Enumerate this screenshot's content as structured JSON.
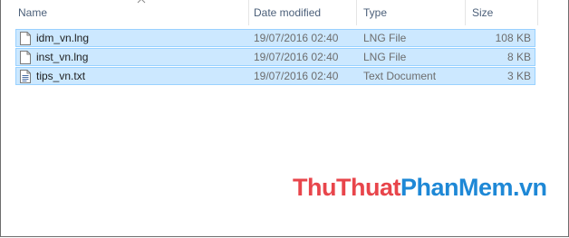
{
  "columns": {
    "name": "Name",
    "date_modified": "Date modified",
    "type": "Type",
    "size": "Size"
  },
  "files": [
    {
      "name": "idm_vn.lng",
      "date": "19/07/2016 02:40",
      "type": "LNG File",
      "size": "108 KB",
      "icon": "document-icon"
    },
    {
      "name": "inst_vn.lng",
      "date": "19/07/2016 02:40",
      "type": "LNG File",
      "size": "8 KB",
      "icon": "document-icon"
    },
    {
      "name": "tips_vn.txt",
      "date": "19/07/2016 02:40",
      "type": "Text Document",
      "size": "3 KB",
      "icon": "text-document-icon"
    }
  ],
  "watermark": {
    "part1": "ThuThuat",
    "part2": "PhanMem",
    "part3": ".vn"
  },
  "colors": {
    "selection_bg": "#cce8ff",
    "selection_border": "#99d1ff",
    "header_text": "#4c607a",
    "watermark_red": "#e8454b",
    "watermark_blue": "#1e88d6"
  }
}
